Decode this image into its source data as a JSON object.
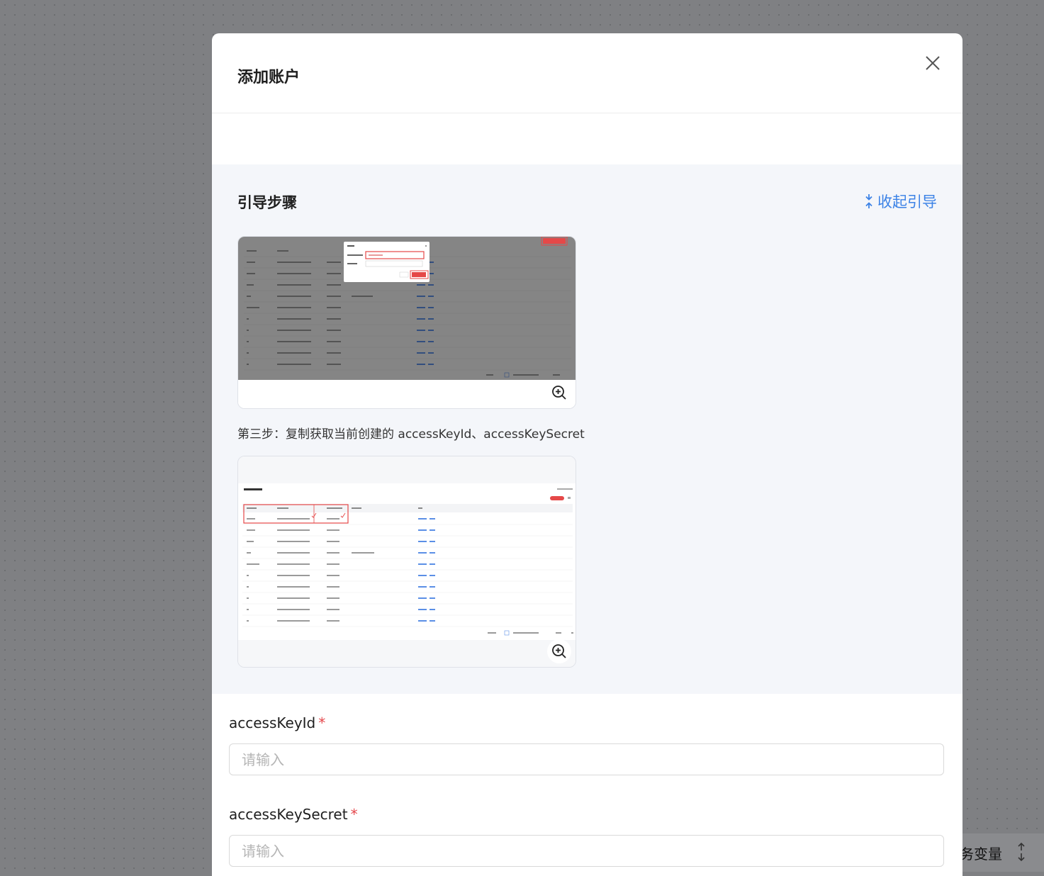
{
  "background": {
    "side_chip_text": "务变量",
    "side_chip_arrows": "↑↓"
  },
  "modal": {
    "title": "添加账户",
    "close_icon": "close-icon"
  },
  "guide": {
    "title": "引导步骤",
    "collapse_label": "收起引导",
    "step3_text": "第三步：复制获取当前创建的 accessKeyId、accessKeySecret",
    "screenshot1": {
      "dialog_title": "新建",
      "dialog_cancel": "取消",
      "dialog_ok": "确定",
      "top_button": "创建API Key"
    },
    "screenshot2": {
      "page_title": "API Key管理",
      "top_button": "创建API Key",
      "columns": [
        "名称/备注",
        "accessKeyId",
        "accessKeySecret",
        "创建时间",
        "操作"
      ]
    }
  },
  "form": {
    "access_key_id": {
      "label": "accessKeyId",
      "required_mark": "*",
      "placeholder": "请输入"
    },
    "access_key_secret": {
      "label": "accessKeySecret",
      "required_mark": "*",
      "placeholder": "请输入"
    }
  },
  "colors": {
    "accent": "#3b82e6",
    "required": "#e5484d",
    "guide_bg": "#f4f6fa"
  }
}
